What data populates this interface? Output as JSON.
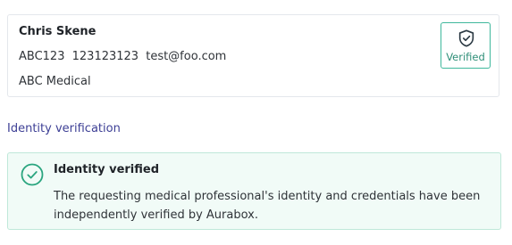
{
  "profile": {
    "name": "Chris Skene",
    "id_code": "ABC123",
    "phone": "123123123",
    "email": "test@foo.com",
    "organization": "ABC Medical",
    "badge": {
      "label": "Verified",
      "icon": "shield-check-icon",
      "color": "#3fb89c"
    }
  },
  "section": {
    "title": "Identity verification"
  },
  "status": {
    "icon": "check-circle-icon",
    "title": "Identity verified",
    "message": "The requesting medical professional's identity and credentials have been independently verified by Aurabox.",
    "border_color": "#bfe8d9",
    "background_color": "#f1fbf7",
    "accent_color": "#2aa57f"
  }
}
